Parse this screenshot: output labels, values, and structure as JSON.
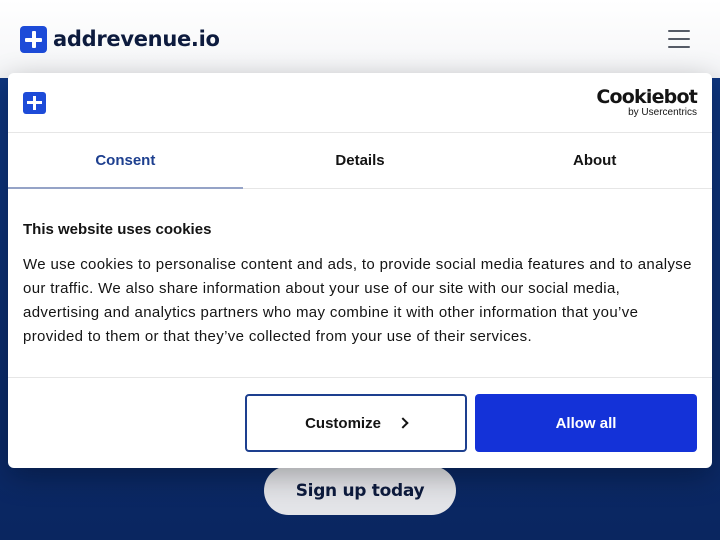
{
  "site": {
    "logo_text": "addrevenue.io",
    "signup_label": "Sign up today"
  },
  "cookie_dialog": {
    "brand_name": "Cookiebot",
    "brand_sub": "by Usercentrics",
    "tabs": [
      {
        "label": "Consent",
        "active": true
      },
      {
        "label": "Details",
        "active": false
      },
      {
        "label": "About",
        "active": false
      }
    ],
    "heading": "This website uses cookies",
    "body": "We use cookies to personalise content and ads, to provide social media features and to analyse our traffic. We also share information about your use of our site with our social media, advertising and analytics partners who may combine it with other information that you’ve provided to them or that they’ve collected from your use of their services.",
    "customize_label": "Customize",
    "allow_all_label": "Allow all"
  },
  "colors": {
    "brand_blue": "#1d4bd8",
    "hero_navy": "#0b2a6b",
    "allow_button": "#1432d8",
    "active_tab_text": "#1d3f8f"
  }
}
